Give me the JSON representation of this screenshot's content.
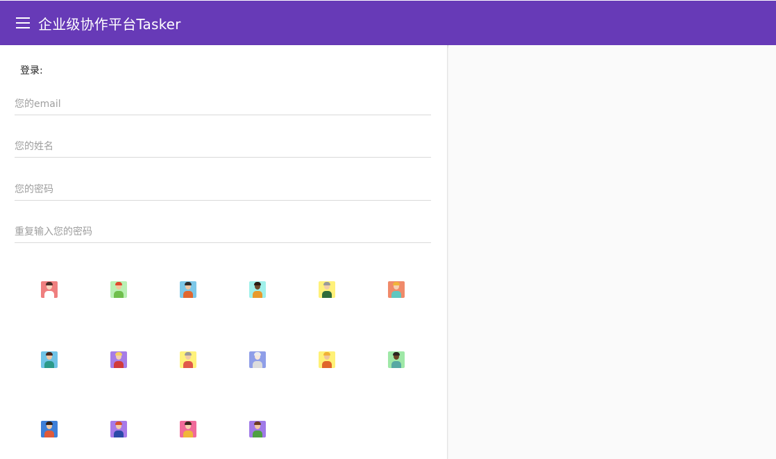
{
  "app": {
    "title": "企业级协作平台Tasker",
    "menu_icon": "menu-icon",
    "primary_color": "#673ab7"
  },
  "login": {
    "heading": "登录:",
    "fields": [
      {
        "name": "email",
        "placeholder": "您的email",
        "value": ""
      },
      {
        "name": "name",
        "placeholder": "您的姓名",
        "value": ""
      },
      {
        "name": "password",
        "placeholder": "您的密码",
        "value": ""
      },
      {
        "name": "confirm_password",
        "placeholder": "重复输入您的密码",
        "value": ""
      }
    ]
  },
  "avatars": [
    {
      "id": "avatar-1",
      "bg": "#ef7f7f",
      "skin": "#f7d6bf",
      "hair": "#4a2f2a",
      "shirt": "#ffffff"
    },
    {
      "id": "avatar-2",
      "bg": "#b9f0b3",
      "skin": "#f2c79e",
      "hair": "#e0492f",
      "shirt": "#6fbf4c"
    },
    {
      "id": "avatar-3",
      "bg": "#7cc7e8",
      "skin": "#f0c7a3",
      "hair": "#2d2d2d",
      "shirt": "#e0672f"
    },
    {
      "id": "avatar-4",
      "bg": "#9ff0ea",
      "skin": "#6b4a2c",
      "hair": "#2b1c12",
      "shirt": "#e89a2c"
    },
    {
      "id": "avatar-5",
      "bg": "#fff17a",
      "skin": "#f1cda9",
      "hair": "#9a9a9a",
      "shirt": "#2f6b3a"
    },
    {
      "id": "avatar-6",
      "bg": "#f08a6a",
      "skin": "#f6d0b0",
      "hair": "#f0b43a",
      "shirt": "#5fc7c0"
    },
    {
      "id": "avatar-7",
      "bg": "#6fc3e6",
      "skin": "#f1c6a2",
      "hair": "#4a2a22",
      "shirt": "#2b9a8a"
    },
    {
      "id": "avatar-8",
      "bg": "#a67de6",
      "skin": "#f3d0b1",
      "hair": "#f5cf62",
      "shirt": "#d13b3b"
    },
    {
      "id": "avatar-9",
      "bg": "#fff27a",
      "skin": "#f1cba7",
      "hair": "#9b9b9b",
      "shirt": "#e05a4a"
    },
    {
      "id": "avatar-10",
      "bg": "#8f9ee8",
      "skin": "#f6e8dc",
      "hair": "#ededed",
      "shirt": "#dcdcdc"
    },
    {
      "id": "avatar-11",
      "bg": "#fff176",
      "skin": "#f0c39b",
      "hair": "#f0b038",
      "shirt": "#e0662a"
    },
    {
      "id": "avatar-12",
      "bg": "#9fe8a7",
      "skin": "#6a4426",
      "hair": "#2b2420",
      "shirt": "#57a9a3"
    },
    {
      "id": "avatar-13",
      "bg": "#3e7fd8",
      "skin": "#f2c9a2",
      "hair": "#2e2220",
      "shirt": "#e05a3a"
    },
    {
      "id": "avatar-14",
      "bg": "#a77ae8",
      "skin": "#f3cba7",
      "hair": "#d9502f",
      "shirt": "#2b4aa8"
    },
    {
      "id": "avatar-15",
      "bg": "#f06a9a",
      "skin": "#f5cfae",
      "hair": "#3a2620",
      "shirt": "#f0b63a"
    },
    {
      "id": "avatar-16",
      "bg": "#a07ae8",
      "skin": "#f2c8a4",
      "hair": "#6a3a22",
      "shirt": "#4f9f43"
    }
  ]
}
